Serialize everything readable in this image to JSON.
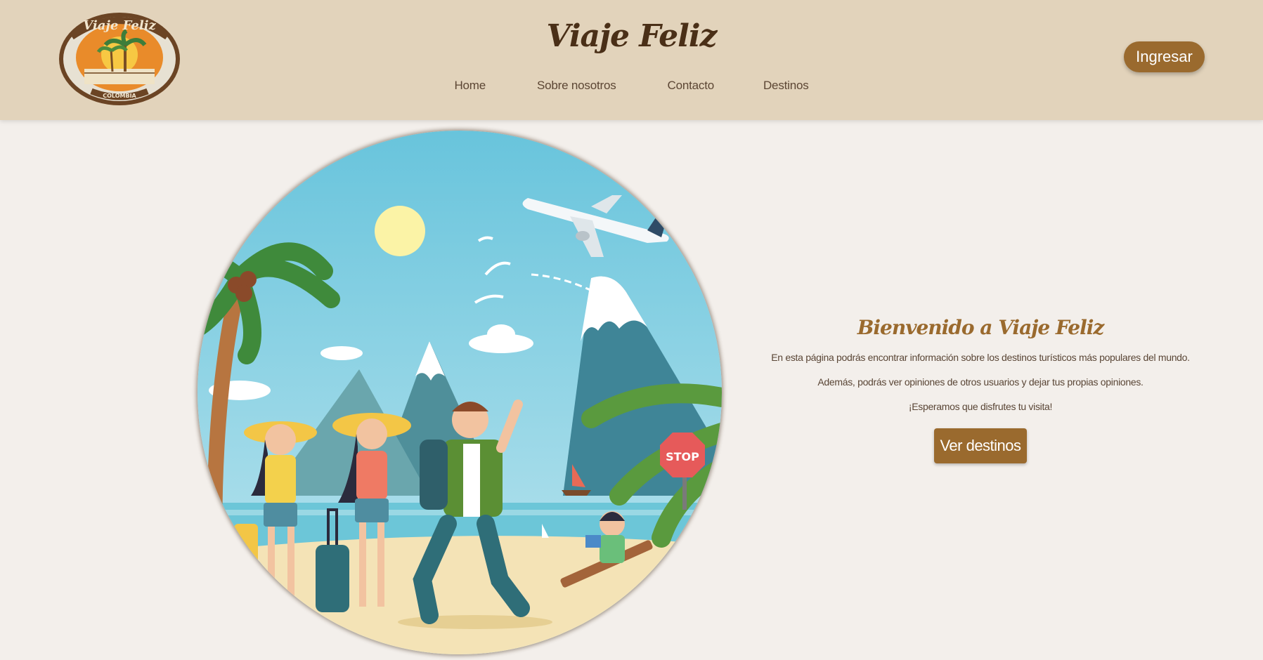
{
  "header": {
    "title": "Viaje Feliz",
    "logo_text": "Viaje Feliz",
    "logo_subtext": "COLOMBIA",
    "nav": [
      {
        "label": "Home"
      },
      {
        "label": "Sobre nosotros"
      },
      {
        "label": "Contacto"
      },
      {
        "label": "Destinos"
      }
    ],
    "login_label": "Ingresar"
  },
  "hero": {
    "sign_text": "STOP"
  },
  "welcome": {
    "title": "Bienvenido a Viaje Feliz",
    "paragraphs": [
      "En esta página podrás encontrar información sobre los destinos turísticos más populares del mundo.",
      "Además, podrás ver opiniones de otros usuarios y dejar tus propias opiniones.",
      "¡Esperamos que disfrutes tu visita!"
    ],
    "cta_label": "Ver destinos"
  },
  "colors": {
    "header_bg": "#e2d3bb",
    "page_bg": "#f3efeb",
    "accent": "#9a6a2e",
    "title_dark": "#4a2f17"
  }
}
